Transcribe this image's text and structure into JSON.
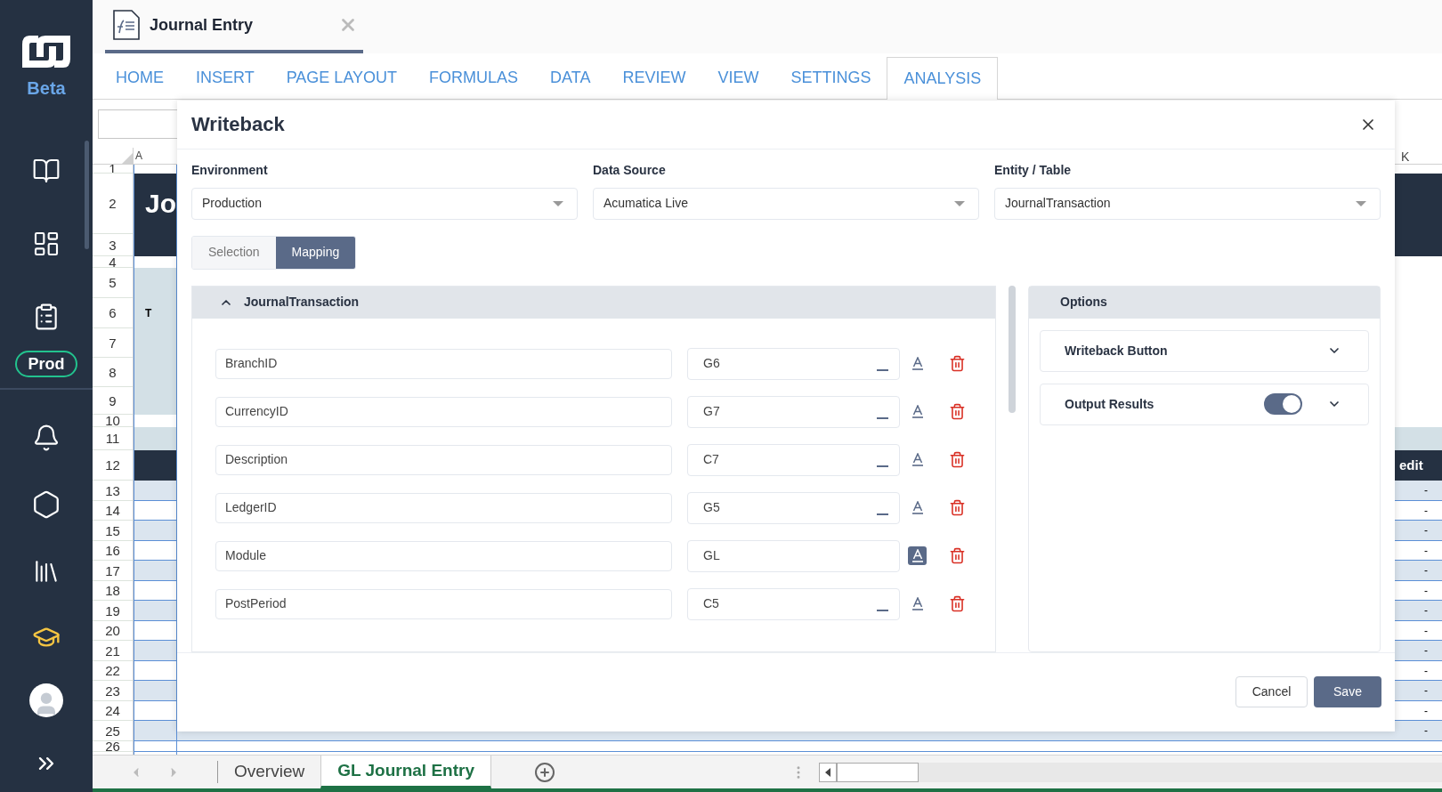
{
  "sidebar": {
    "badge": "Beta",
    "env_badge": "Prod"
  },
  "document_tab": {
    "title": "Journal Entry"
  },
  "ribbon_tabs": [
    {
      "label": "HOME",
      "selected": false
    },
    {
      "label": "INSERT",
      "selected": false
    },
    {
      "label": "PAGE LAYOUT",
      "selected": false
    },
    {
      "label": "FORMULAS",
      "selected": false
    },
    {
      "label": "DATA",
      "selected": false
    },
    {
      "label": "REVIEW",
      "selected": false
    },
    {
      "label": "VIEW",
      "selected": false
    },
    {
      "label": "SETTINGS",
      "selected": false
    },
    {
      "label": "ANALYSIS",
      "selected": true
    }
  ],
  "sheet": {
    "column_a": "A",
    "column_k": "K",
    "banner_text": "Jo",
    "row_6_text": "T",
    "header_text": "edit",
    "dash": "-",
    "rows": [
      "1",
      "2",
      "3",
      "4",
      "5",
      "6",
      "7",
      "8",
      "9",
      "10",
      "11",
      "12",
      "13",
      "14",
      "15",
      "16",
      "17",
      "18",
      "19",
      "20",
      "21",
      "22",
      "23",
      "24",
      "25",
      "26"
    ]
  },
  "sheet_tabs": [
    {
      "label": "Overview",
      "selected": false
    },
    {
      "label": "GL Journal Entry",
      "selected": true
    }
  ],
  "dialog": {
    "title": "Writeback",
    "selects": [
      {
        "label": "Environment",
        "value": "Production"
      },
      {
        "label": "Data Source",
        "value": "Acumatica Live"
      },
      {
        "label": "Entity / Table",
        "value": "JournalTransaction"
      }
    ],
    "modes": [
      {
        "label": "Selection",
        "selected": false
      },
      {
        "label": "Mapping",
        "selected": true
      }
    ],
    "mapping": {
      "title": "JournalTransaction",
      "expanded": true,
      "fields": [
        {
          "field": "BranchID",
          "value": "G6",
          "constant": false
        },
        {
          "field": "CurrencyID",
          "value": "G7",
          "constant": false
        },
        {
          "field": "Description",
          "value": "C7",
          "constant": false
        },
        {
          "field": "LedgerID",
          "value": "G5",
          "constant": false
        },
        {
          "field": "Module",
          "value": "GL",
          "constant": true
        },
        {
          "field": "PostPeriod",
          "value": "C5",
          "constant": false
        }
      ]
    },
    "options": {
      "title": "Options",
      "items": [
        {
          "label": "Writeback Button",
          "kind": "expander"
        },
        {
          "label": "Output Results",
          "kind": "toggle",
          "on": true
        }
      ]
    },
    "buttons": [
      {
        "label": "Cancel",
        "kind": "secondary"
      },
      {
        "label": "Save",
        "kind": "primary"
      }
    ]
  }
}
